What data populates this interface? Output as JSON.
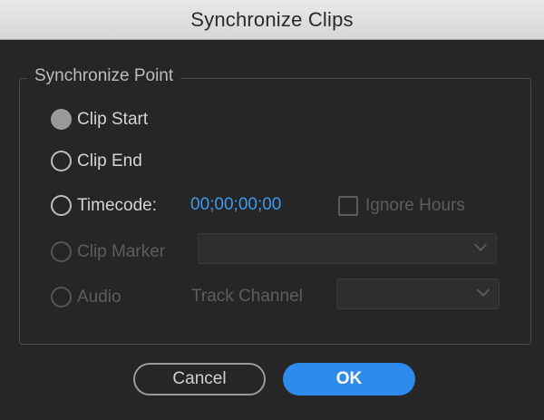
{
  "dialog": {
    "title": "Synchronize Clips"
  },
  "sync_point": {
    "legend": "Synchronize Point",
    "options": [
      {
        "label": "Clip Start",
        "selected": true,
        "enabled": true
      },
      {
        "label": "Clip End",
        "selected": false,
        "enabled": true
      },
      {
        "label": "Timecode:",
        "selected": false,
        "enabled": true
      },
      {
        "label": "Clip Marker",
        "selected": false,
        "enabled": false
      },
      {
        "label": "Audio",
        "selected": false,
        "enabled": false
      }
    ],
    "timecode_value": "00;00;00;00",
    "ignore_hours": {
      "label": "Ignore Hours",
      "checked": false,
      "enabled": false
    },
    "clip_marker_select": {
      "value": ""
    },
    "track_channel": {
      "label": "Track Channel",
      "value": ""
    }
  },
  "buttons": {
    "cancel": "Cancel",
    "ok": "OK"
  },
  "colors": {
    "accent": "#2d8ceb",
    "timecode": "#3a9bf0",
    "background": "#262626"
  }
}
